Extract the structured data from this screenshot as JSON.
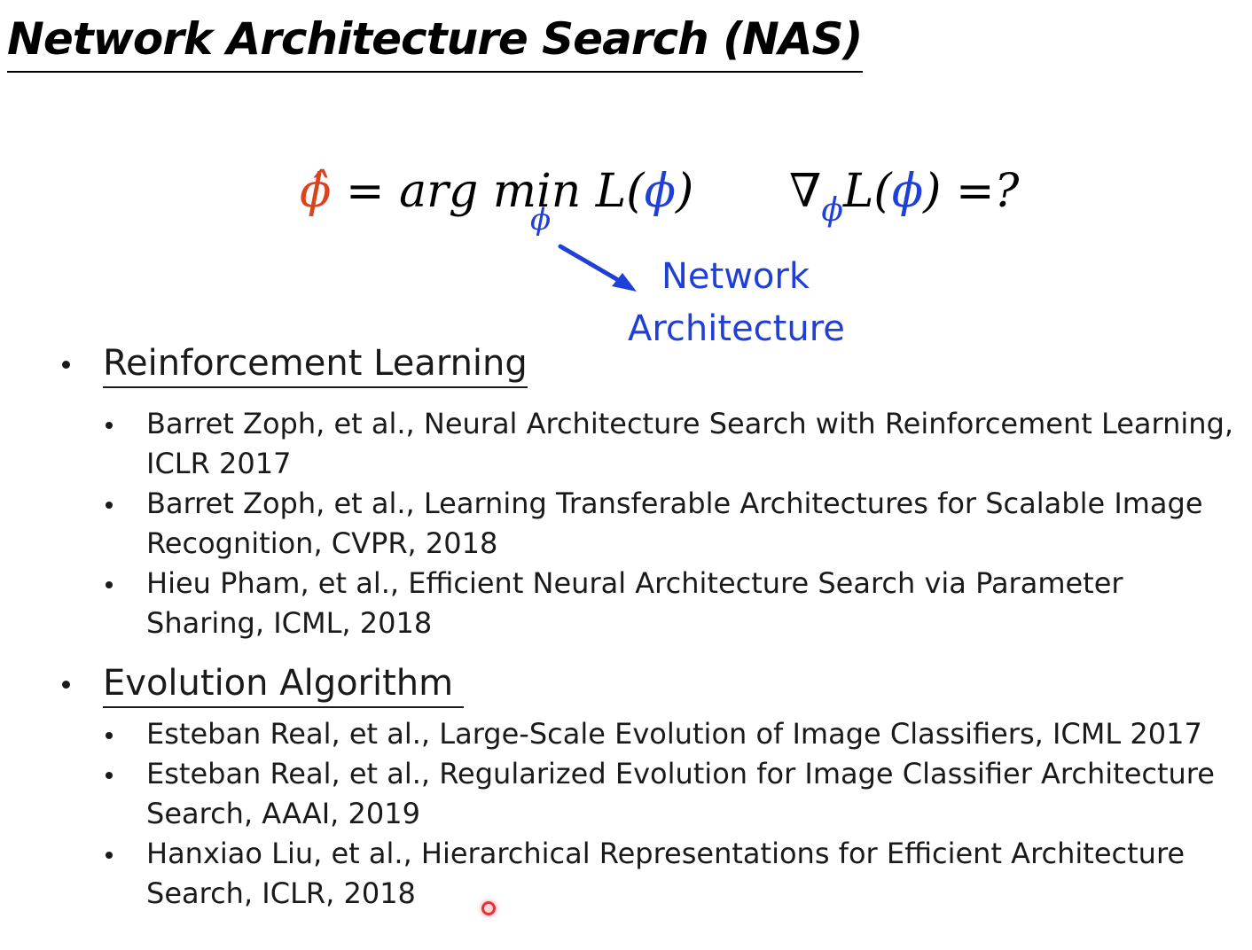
{
  "title": "Network Architecture Search (NAS)",
  "formula": {
    "phi_hat": "ϕ̂",
    "equals": " = ",
    "argmin": "arg min ",
    "loss_open": "L(",
    "phi": "ϕ",
    "loss_close": ")",
    "nabla": "∇",
    "nabla_sub": "ϕ",
    "gradient_rest_open": "L(",
    "gradient_phi": "ϕ",
    "gradient_rest_close": ") =?",
    "argmin_subscript": "ϕ"
  },
  "annotation": {
    "line1": "Network",
    "line2": "Architecture"
  },
  "sections": [
    {
      "heading": "Reinforcement Learning",
      "references": [
        "Barret Zoph, et al., Neural Architecture Search with Reinforcement Learning, ICLR 2017",
        "Barret Zoph, et al., Learning Transferable Architectures for Scalable Image Recognition, CVPR, 2018",
        "Hieu Pham, et al., Efficient Neural Architecture Search via Parameter Sharing, ICML, 2018"
      ]
    },
    {
      "heading": "Evolution Algorithm",
      "references": [
        "Esteban Real, et al., Large-Scale Evolution of Image Classifiers, ICML 2017",
        "Esteban Real, et al., Regularized Evolution for Image Classifier Architecture Search, AAAI, 2019",
        "Hanxiao Liu, et al., Hierarchical Representations for Efficient Architecture Search, ICLR, 2018"
      ]
    }
  ],
  "colors": {
    "accent_red": "#d9441f",
    "accent_blue": "#1f3fd6"
  }
}
